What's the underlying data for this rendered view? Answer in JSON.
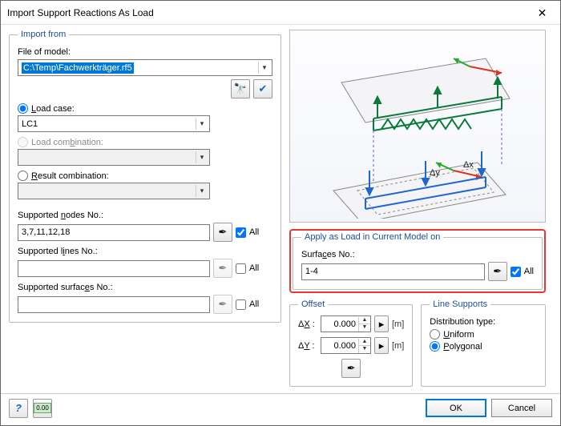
{
  "window": {
    "title": "Import Support Reactions As Load"
  },
  "import_from": {
    "legend": "Import from",
    "file_label": "File of model:",
    "file_path": "C:\\Temp\\Fachwerkträger.rf5",
    "btn_browse_title": "Browse",
    "btn_check_title": "Verify",
    "radio_load_case": "Load case:",
    "load_case_value": "LC1",
    "radio_load_combo": "Load combination:",
    "radio_result_combo": "Result combination:",
    "supported_nodes_label": "Supported nodes No.:",
    "supported_nodes_value": "3,7,11,12,18",
    "supported_lines_label": "Supported lines No.:",
    "supported_surfaces_label": "Supported surfaces No.:",
    "all_label": "All"
  },
  "apply": {
    "legend": "Apply as Load in Current Model on",
    "surfaces_label": "Surfaces No.:",
    "surfaces_value": "1-4",
    "all_label": "All"
  },
  "offset": {
    "legend": "Offset",
    "dx_label": "ΔX :",
    "dy_label": "ΔY :",
    "dx_value": "0.000",
    "dy_value": "0.000",
    "unit": "[m]"
  },
  "line_supports": {
    "legend": "Line Supports",
    "dist_type_label": "Distribution type:",
    "uniform": "Uniform",
    "polygonal": "Polygonal"
  },
  "footer": {
    "ok": "OK",
    "cancel": "Cancel"
  },
  "preview": {
    "dx": "Δx",
    "dy": "Δy"
  }
}
